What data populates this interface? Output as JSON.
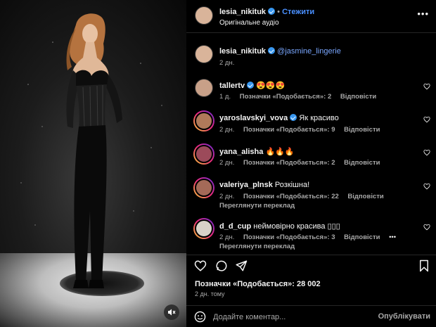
{
  "header": {
    "username": "lesia_nikituk",
    "separator": "•",
    "follow_label": "Стежити",
    "audio": "Оригінальне аудіо"
  },
  "caption": {
    "username": "lesia_nikituk",
    "mention": "@jasmine_lingerie",
    "time": "2 дн."
  },
  "comments": [
    {
      "username": "tallertv",
      "verified": true,
      "text": "😍😍😍",
      "time": "1 д.",
      "likes": "Позначки «Подобається»: 2",
      "reply": "Відповісти",
      "extra": ""
    },
    {
      "username": "yaroslavskyi_vova",
      "verified": true,
      "text": "Як красиво",
      "time": "2 дн.",
      "likes": "Позначки «Подобається»: 9",
      "reply": "Відповісти",
      "extra": ""
    },
    {
      "username": "yana_alisha",
      "verified": false,
      "text": "🔥🔥🔥",
      "time": "2 дн.",
      "likes": "Позначки «Подобається»: 2",
      "reply": "Відповісти",
      "extra": ""
    },
    {
      "username": "valeriya_plnsk",
      "verified": false,
      "text": "Розкішна!",
      "time": "2 дн.",
      "likes": "Позначки «Подобається»: 22",
      "reply": "Відповісти",
      "extra": "Переглянути переклад"
    },
    {
      "username": "d_d_cup",
      "verified": false,
      "text": "неймовірно красива ▯▯▯",
      "time": "2 дн.",
      "likes": "Позначки «Подобається»: 3",
      "reply": "Відповісти",
      "extra": "Переглянути переклад",
      "more": "•••"
    }
  ],
  "likes_total": "Позначки «Подобається»: 28 002",
  "posted": "2 дн. тому",
  "composer": {
    "placeholder": "Додайте коментар...",
    "post_label": "Опублікувати"
  },
  "more_menu": "•••",
  "colors": {
    "accent": "#4a90ff",
    "verified": "#3897f0",
    "muted": "#a8a8a8"
  }
}
